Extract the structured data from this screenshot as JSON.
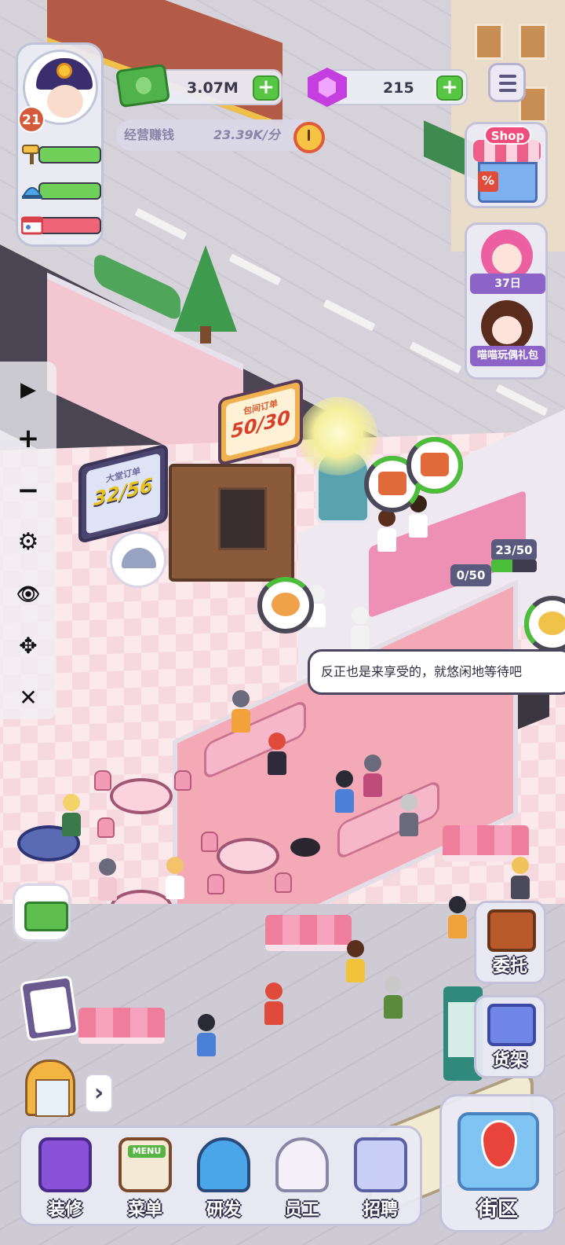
{
  "player": {
    "level": "21",
    "stats": [
      {
        "name": "paint-roller-icon",
        "level": 1.0,
        "color": "#6fd15a"
      },
      {
        "name": "service-bell-icon",
        "level": 1.0,
        "color": "#6fd15a"
      },
      {
        "name": "id-card-icon",
        "level": 1.0,
        "color": "#f06478"
      }
    ]
  },
  "currency": {
    "cash": "3.07M",
    "gems": "215"
  },
  "income": {
    "label": "经营赚钱",
    "rate": "23.39K/分"
  },
  "shop": {
    "sign": "Shop",
    "discount_symbol": "%"
  },
  "event": {
    "days_label": "37日",
    "pack_label": "喵喵玩偶礼包"
  },
  "side_tools": [
    {
      "name": "play-icon",
      "glyph": "▶"
    },
    {
      "name": "zoom-in-icon",
      "glyph": "+"
    },
    {
      "name": "zoom-out-icon",
      "glyph": "−"
    },
    {
      "name": "settings-gear-icon",
      "glyph": "⚙"
    },
    {
      "name": "eye-icon",
      "glyph": "👁"
    },
    {
      "name": "move-arrows-icon",
      "glyph": "✥"
    },
    {
      "name": "close-icon",
      "glyph": "✕"
    }
  ],
  "orders": {
    "takeout": {
      "title": "包间订单",
      "value": "50/30"
    },
    "hall": {
      "title": "大堂订单",
      "value": "32/56"
    }
  },
  "counters": {
    "left": "0/50",
    "right": "23/50",
    "right_progress": 0.46
  },
  "speech": "反正也是来享受的，就悠闲地等待吧",
  "right_buttons": {
    "commission": "委托",
    "shelf": "货架"
  },
  "nav": {
    "decorate": "装修",
    "menu": "菜单",
    "menu_tag": "MENU",
    "research": "研发",
    "staff": "员工",
    "recruit": "招聘",
    "district": "街区"
  },
  "colors": {
    "plus_green": "#57c743",
    "gem_purple": "#c53ee0",
    "bar_dark": "#4b4858"
  }
}
